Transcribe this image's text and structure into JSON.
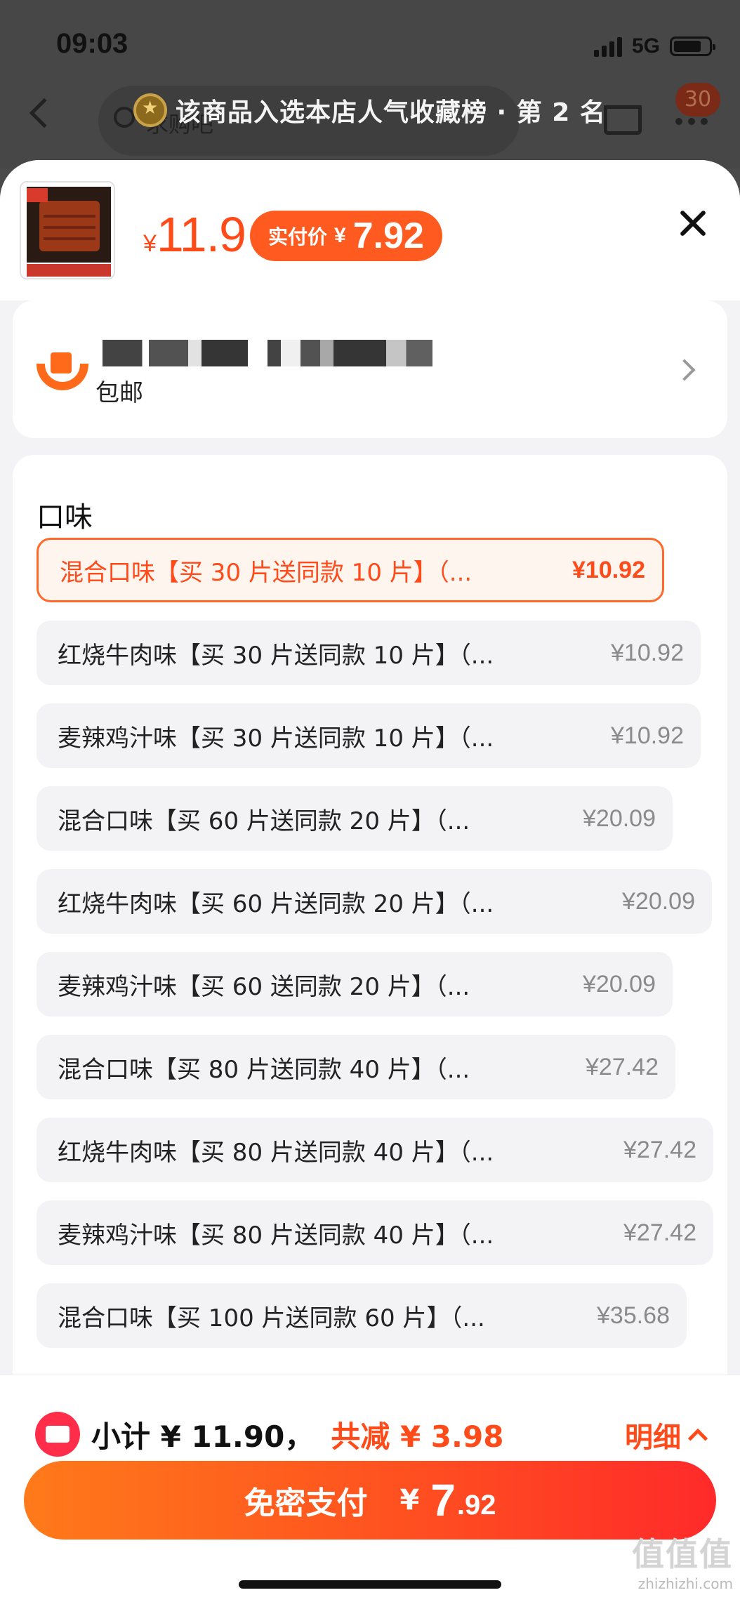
{
  "status_bar": {
    "time": "09:03",
    "network": "5G",
    "battery_level": 0.8
  },
  "nav": {
    "search_placeholder": "求购吧",
    "cart_badge": "30",
    "rank_banner": "该商品入选本店人气收藏榜 · 第 2 名"
  },
  "product": {
    "currency": "¥",
    "price": "11.9",
    "paid_label": "实付价",
    "paid_currency": "¥",
    "paid_price": "7.92"
  },
  "shipping": {
    "label": "包邮"
  },
  "flavor": {
    "title": "口味",
    "options": [
      {
        "label": "混合口味【买 30 片送同款 10 片】（...",
        "price": "¥10.92",
        "selected": true
      },
      {
        "label": "红烧牛肉味【买 30 片送同款 10 片】（...",
        "price": "¥10.92",
        "selected": false
      },
      {
        "label": "麦辣鸡汁味【买 30 片送同款 10 片】（...",
        "price": "¥10.92",
        "selected": false
      },
      {
        "label": "混合口味【买 60 片送同款 20 片】（...",
        "price": "¥20.09",
        "selected": false
      },
      {
        "label": "红烧牛肉味【买 60 片送同款 20 片】（...",
        "price": "¥20.09",
        "selected": false
      },
      {
        "label": "麦辣鸡汁味【买 60 送同款 20 片】（...",
        "price": "¥20.09",
        "selected": false
      },
      {
        "label": "混合口味【买 80 片送同款 40 片】（...",
        "price": "¥27.42",
        "selected": false
      },
      {
        "label": "红烧牛肉味【买 80 片送同款 40 片】（...",
        "price": "¥27.42",
        "selected": false
      },
      {
        "label": "麦辣鸡汁味【买 80 片送同款 40 片】（...",
        "price": "¥27.42",
        "selected": false
      },
      {
        "label": "混合口味【买 100 片送同款 60 片】（...",
        "price": "¥35.68",
        "selected": false
      }
    ]
  },
  "summary": {
    "subtotal": "小计 ¥ 11.90，",
    "discount": "共减 ¥ 3.98",
    "detail_label": "明细"
  },
  "pay": {
    "label": "免密支付",
    "currency": "¥",
    "amount_int": "7",
    "amount_dec": ".92"
  },
  "watermark": {
    "logo": "值值值",
    "url": "zhizhizhi.com"
  }
}
